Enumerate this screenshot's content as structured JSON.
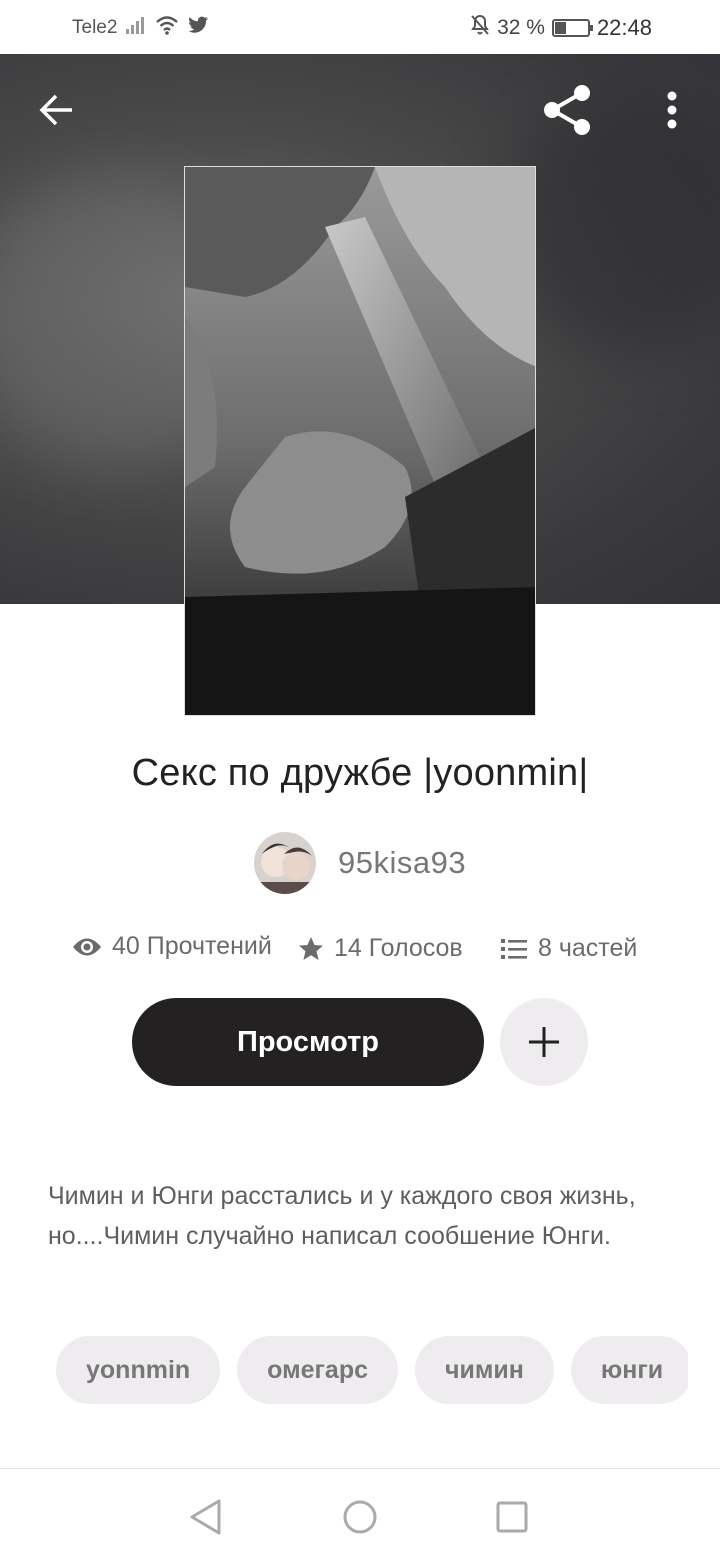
{
  "status_bar": {
    "carrier": "Tele2",
    "battery_percent": "32 %",
    "battery_level": 0.32,
    "time": "22:48",
    "icons": [
      "signal-icon",
      "wifi-icon",
      "twitter-icon",
      "mute-icon",
      "battery-icon"
    ]
  },
  "story": {
    "title": "Секс по дружбе |yoonmin|",
    "author": "95kisa93",
    "stats": {
      "reads": "40 Прочтений",
      "votes": "14 Голосов",
      "parts": "8 частей"
    },
    "read_button": "Просмотр",
    "description": "Чимин и Юнги  расстались и у каждого своя жизнь, но....Чимин случайно написал сообшение Юнги.",
    "tags": [
      "yonnmin",
      "омегарс",
      "чимин",
      "юнги"
    ]
  },
  "colors": {
    "accent_dark": "#232122",
    "chip_bg": "#eeecee",
    "muted_text": "#6b6b6b"
  }
}
